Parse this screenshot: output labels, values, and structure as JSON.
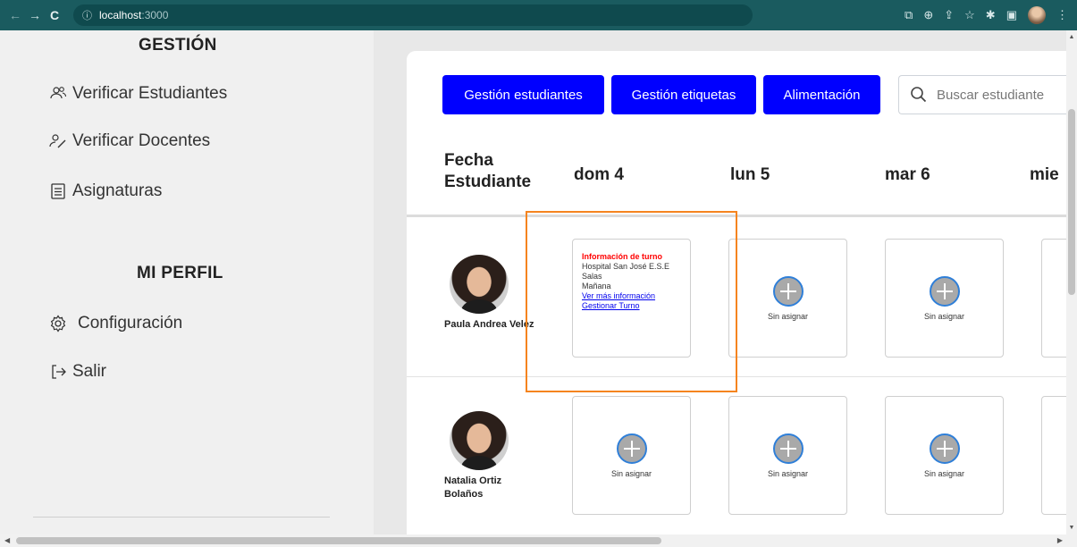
{
  "browser": {
    "url_host": "localhost",
    "url_port": ":3000",
    "info_icon": "info-icon"
  },
  "sidebar": {
    "gestion_title": "GESTIÓN",
    "items": [
      {
        "label": "Verificar Estudiantes",
        "icon": "users-icon"
      },
      {
        "label": "Verificar Docentes",
        "icon": "teacher-icon"
      },
      {
        "label": "Asignaturas",
        "icon": "document-icon"
      }
    ],
    "profile_title": "MI PERFIL",
    "profile_items": [
      {
        "label": "Configuración",
        "icon": "gear-icon"
      },
      {
        "label": "Salir",
        "icon": "logout-icon"
      }
    ]
  },
  "toolbar": {
    "buttons": [
      "Gestión estudiantes",
      "Gestión etiquetas",
      "Alimentación"
    ],
    "search_placeholder": "Buscar estudiante",
    "accent": "#0000ff"
  },
  "schedule": {
    "header_line1": "Fecha",
    "header_line2": "Estudiante",
    "days": [
      "dom 4",
      "lun 5",
      "mar 6",
      "mie"
    ],
    "students": [
      {
        "name": "Paula Andrea Velez"
      },
      {
        "name": "Natalia Ortiz Bolaños"
      }
    ],
    "empty_label": "Sin asignar",
    "shift": {
      "title": "Información de turno",
      "place": "Hospital San José E.S.E",
      "area": "Salas",
      "period": "Mañana",
      "more_link": "Ver más información",
      "manage_link": "Gestionar Turno",
      "title_color": "#ff0000"
    },
    "highlight_color": "#f5841f"
  }
}
